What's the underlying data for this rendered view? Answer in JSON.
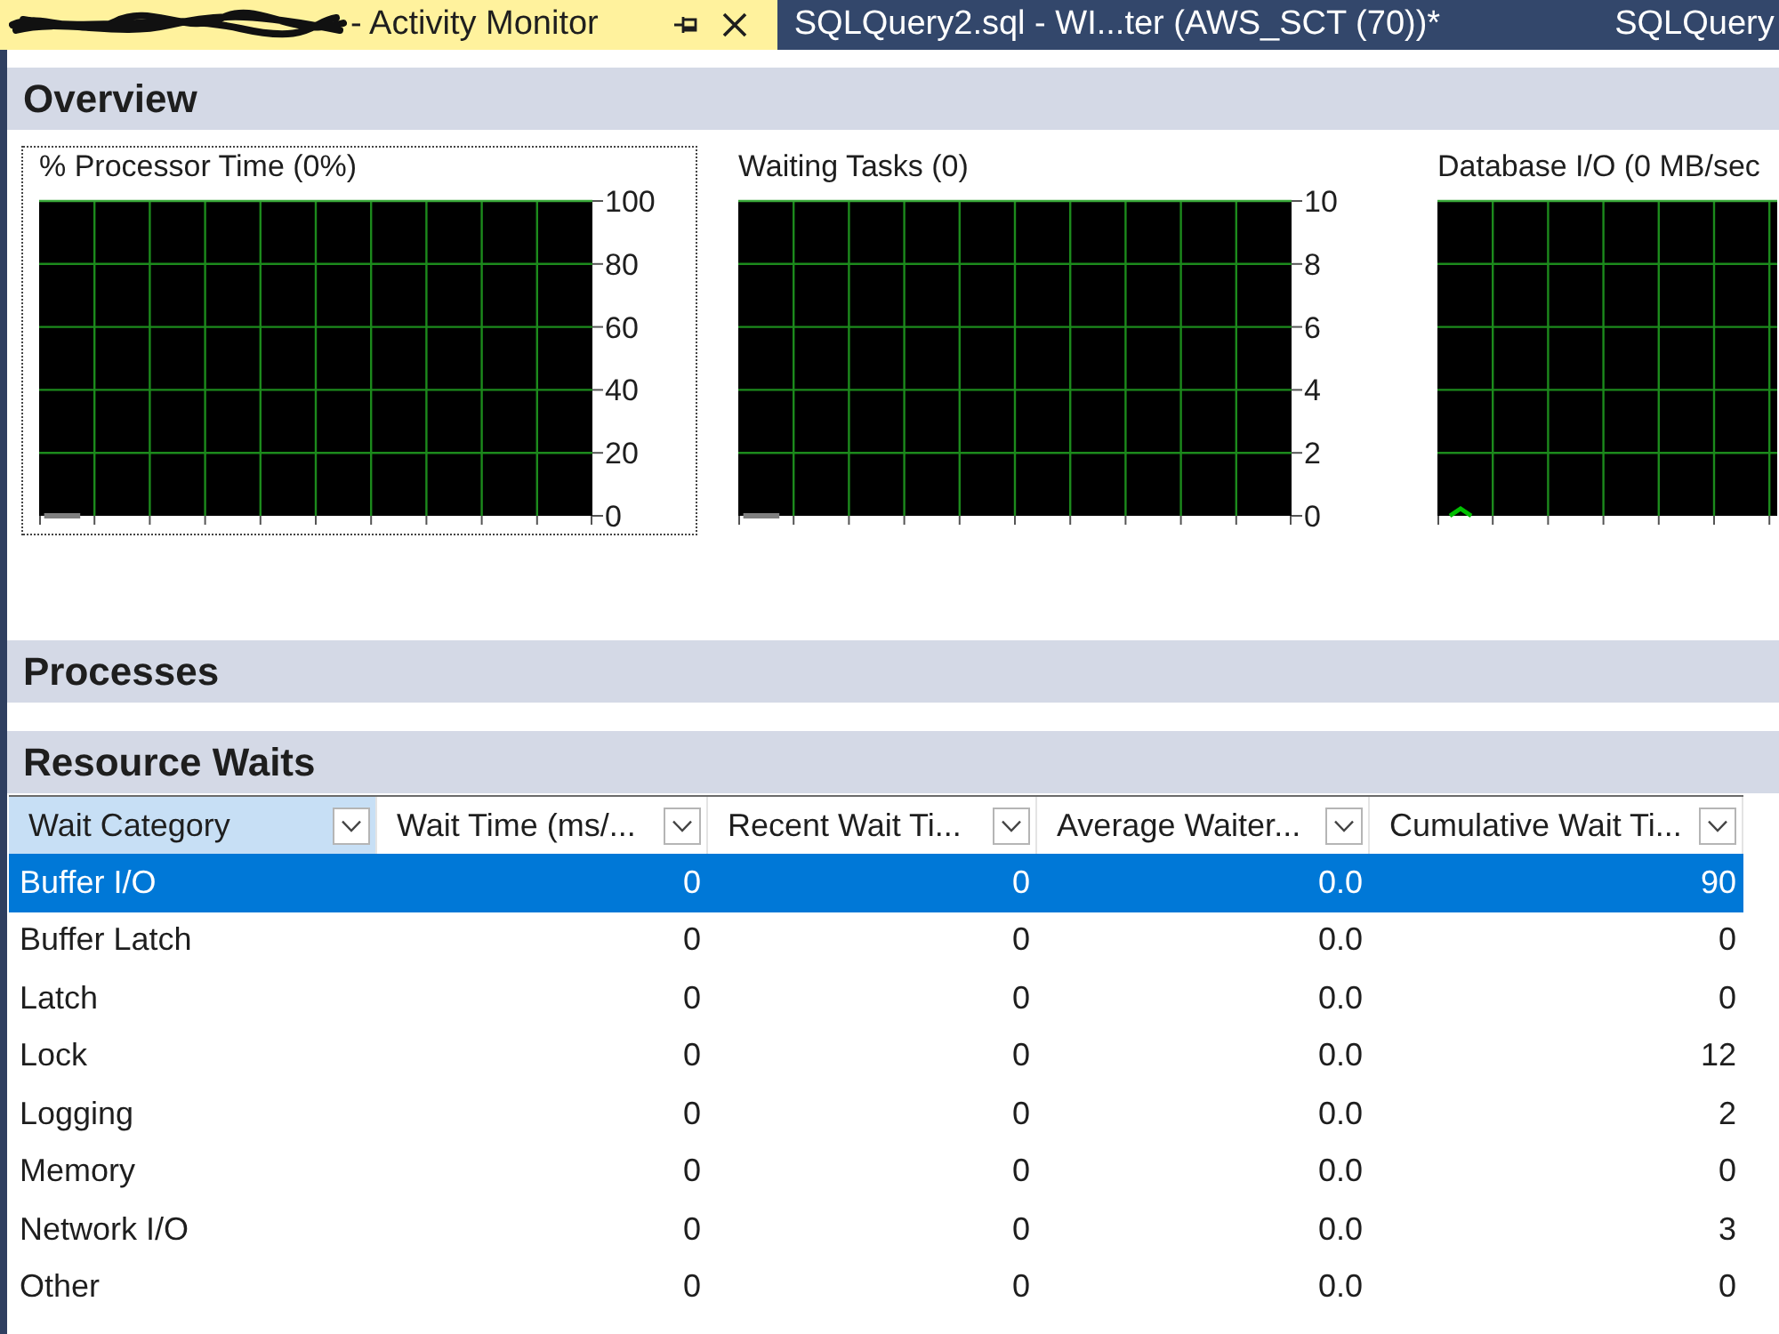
{
  "tabs": [
    {
      "label": "- Activity Monitor",
      "selected": true,
      "redacted": true
    },
    {
      "label": "SQLQuery2.sql - WI...ter (AWS_SCT (70))*",
      "selected": false,
      "redacted": false
    },
    {
      "label": "SQLQuery",
      "selected": false,
      "redacted": false
    }
  ],
  "sections": [
    {
      "kind": "charts",
      "title": "Overview",
      "charts": [
        {
          "kind": "chart",
          "focused": true,
          "chart_data": {
            "type": "line",
            "title": "% Processor Time (0%)",
            "grid": true,
            "categories": [
              null,
              null,
              null,
              null,
              null,
              null,
              null,
              null,
              null,
              null,
              null,
              null,
              null,
              null,
              null,
              null,
              null,
              null,
              null,
              null,
              null,
              null,
              null,
              null,
              null,
              null,
              null,
              null,
              null,
              null,
              null,
              null,
              null,
              null,
              null,
              null
            ],
            "ylim": [
              0,
              100
            ],
            "yticks": [
              0,
              20,
              40,
              60,
              80,
              100
            ],
            "series": [
              {
                "color": "#808080",
                "values": [
                  0,
                  0,
                  0,
                  null,
                  null,
                  null,
                  null,
                  null,
                  null,
                  null,
                  null,
                  null,
                  null,
                  null,
                  null,
                  null,
                  null,
                  null,
                  null,
                  null,
                  null,
                  null,
                  null,
                  null,
                  null,
                  null,
                  null,
                  null,
                  null,
                  null,
                  null,
                  null,
                  null,
                  null,
                  null,
                  null
                ]
              }
            ]
          }
        },
        {
          "kind": "chart",
          "focused": false,
          "chart_data": {
            "type": "line",
            "title": "Waiting Tasks (0)",
            "grid": true,
            "categories": [
              null,
              null,
              null,
              null,
              null,
              null,
              null,
              null,
              null,
              null,
              null,
              null,
              null,
              null,
              null,
              null,
              null,
              null,
              null,
              null,
              null,
              null,
              null,
              null,
              null,
              null,
              null,
              null,
              null,
              null,
              null,
              null,
              null,
              null,
              null,
              null
            ],
            "ylim": [
              0,
              10
            ],
            "yticks": [
              0,
              2,
              4,
              6,
              8,
              10
            ],
            "series": [
              {
                "color": "#808080",
                "values": [
                  0,
                  0,
                  0,
                  null,
                  null,
                  null,
                  null,
                  null,
                  null,
                  null,
                  null,
                  null,
                  null,
                  null,
                  null,
                  null,
                  null,
                  null,
                  null,
                  null,
                  null,
                  null,
                  null,
                  null,
                  null,
                  null,
                  null,
                  null,
                  null,
                  null,
                  null,
                  null,
                  null,
                  null,
                  null,
                  null
                ]
              }
            ]
          }
        },
        {
          "kind": "picture",
          "focused": false,
          "title": "Database I/O (0 MB/sec"
        }
      ]
    },
    {
      "kind": "collapsed",
      "title": "Processes"
    },
    {
      "kind": "table",
      "title": "Resource Waits",
      "table": {
        "columns": [
          {
            "label": "Wait Category",
            "selected": true
          },
          {
            "label": "Wait Time (ms/...",
            "selected": false
          },
          {
            "label": "Recent Wait Ti...",
            "selected": false
          },
          {
            "label": "Average Waiter...",
            "selected": false
          },
          {
            "label": "Cumulative Wait Ti...",
            "selected": false
          }
        ],
        "rows": [
          {
            "selected": true,
            "cells": [
              "Buffer I/O",
              "0",
              "0",
              "0.0",
              "90"
            ]
          },
          {
            "selected": false,
            "cells": [
              "Buffer Latch",
              "0",
              "0",
              "0.0",
              "0"
            ]
          },
          {
            "selected": false,
            "cells": [
              "Latch",
              "0",
              "0",
              "0.0",
              "0"
            ]
          },
          {
            "selected": false,
            "cells": [
              "Lock",
              "0",
              "0",
              "0.0",
              "12"
            ]
          },
          {
            "selected": false,
            "cells": [
              "Logging",
              "0",
              "0",
              "0.0",
              "2"
            ]
          },
          {
            "selected": false,
            "cells": [
              "Memory",
              "0",
              "0",
              "0.0",
              "0"
            ]
          },
          {
            "selected": false,
            "cells": [
              "Network I/O",
              "0",
              "0",
              "0.0",
              "3"
            ]
          },
          {
            "selected": false,
            "cells": [
              "Other",
              "0",
              "0",
              "0.0",
              "0"
            ]
          }
        ]
      }
    }
  ]
}
